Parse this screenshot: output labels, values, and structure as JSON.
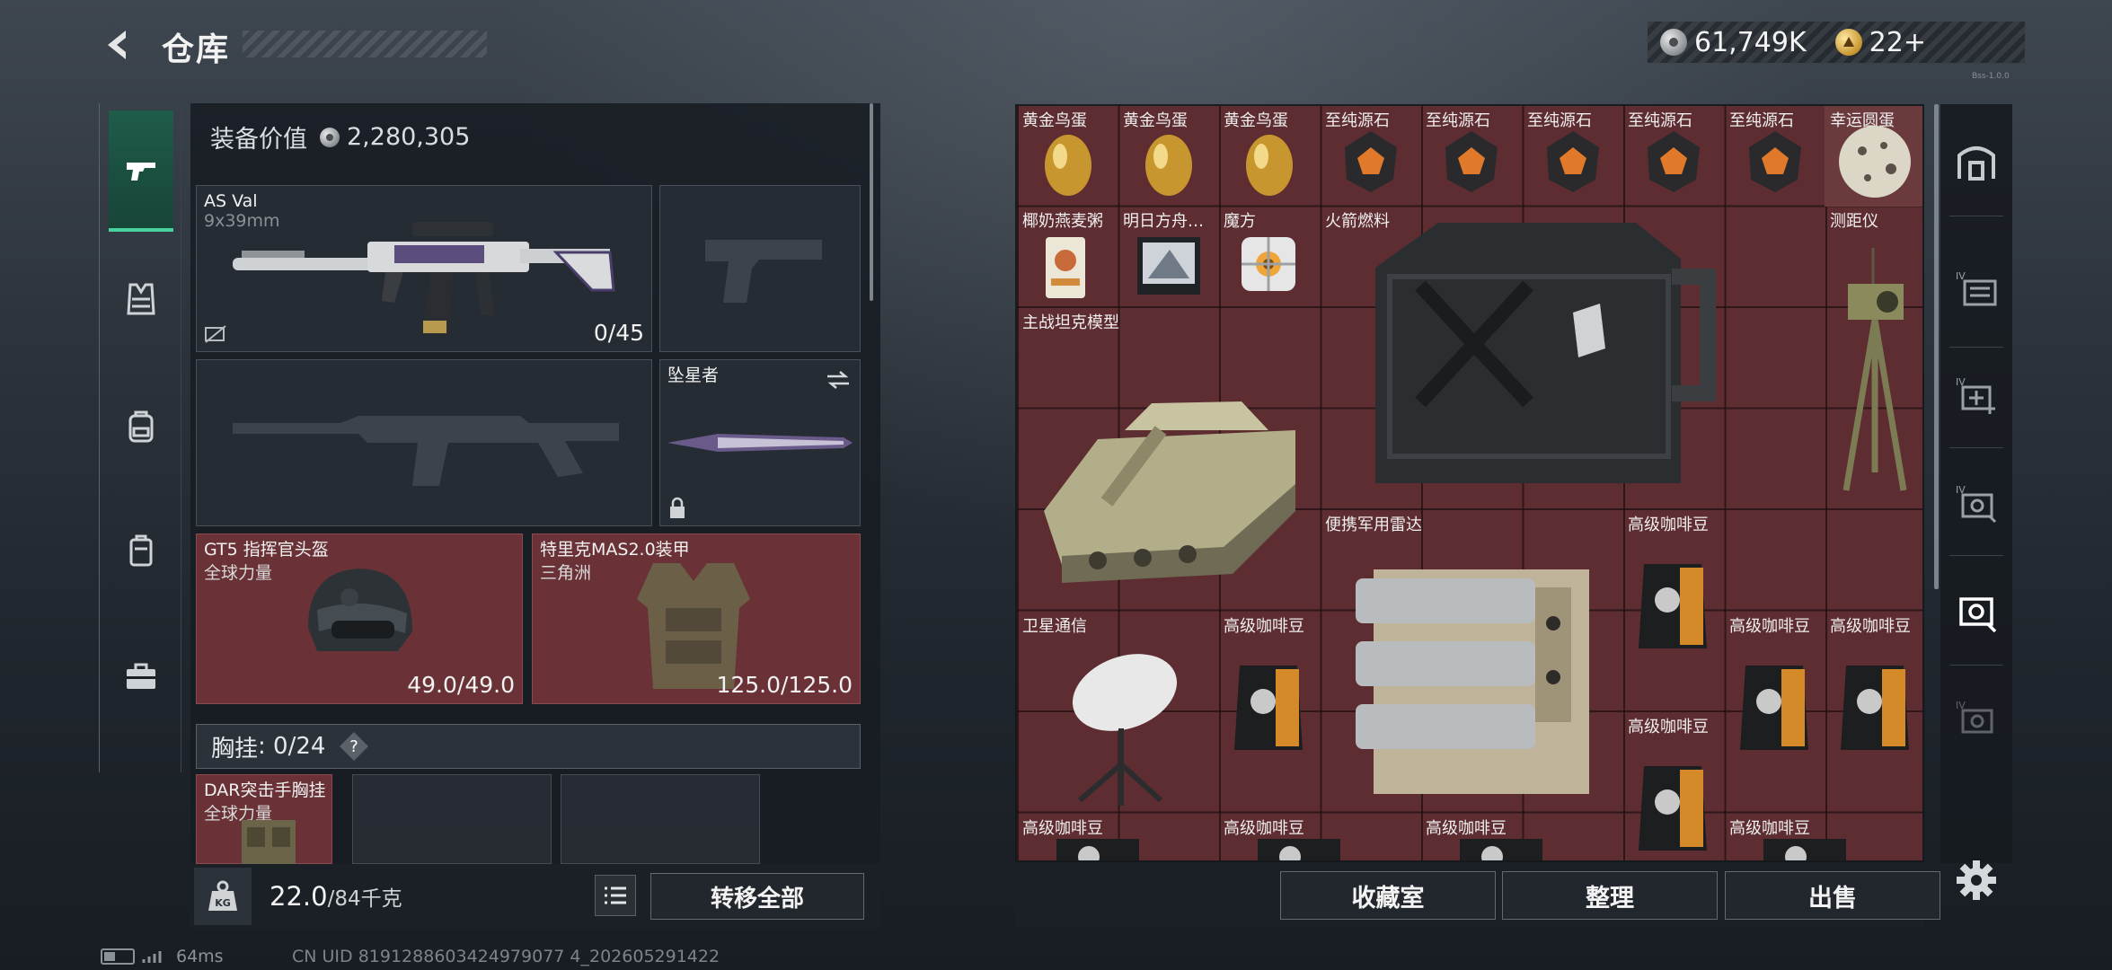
{
  "header": {
    "title": "仓库",
    "currency_silver": "61,749K",
    "currency_gold": "22+",
    "version_tag": "Bss-1.0.0"
  },
  "equipment": {
    "value_label": "装备价值",
    "value": "2,280,305",
    "primary": {
      "name": "AS Val",
      "caliber": "9x39mm",
      "ammo": "0/45"
    },
    "melee": {
      "name": "坠星者"
    },
    "helmet": {
      "name": "GT5 指挥官头盔",
      "sub": "全球力量",
      "durability": "49.0/49.0"
    },
    "armor": {
      "name": "特里克MAS2.0装甲",
      "sub": "三角洲",
      "durability": "125.0/125.0"
    },
    "chest_rig": {
      "label": "胸挂",
      "count": "0/24",
      "help": "?",
      "name": "DAR突击手胸挂",
      "sub": "全球力量"
    },
    "weight": {
      "current": "22.0",
      "max": "/84千克"
    },
    "transfer_all": "转移全部"
  },
  "storage": {
    "items": [
      {
        "name": "黄金鸟蛋",
        "icon": "golden-egg-icon"
      },
      {
        "name": "黄金鸟蛋",
        "icon": "golden-egg-icon"
      },
      {
        "name": "黄金鸟蛋",
        "icon": "golden-egg-icon"
      },
      {
        "name": "至纯源石",
        "icon": "source-stone-icon"
      },
      {
        "name": "至纯源石",
        "icon": "source-stone-icon"
      },
      {
        "name": "至纯源石",
        "icon": "source-stone-icon"
      },
      {
        "name": "至纯源石",
        "icon": "source-stone-icon"
      },
      {
        "name": "至纯源石",
        "icon": "source-stone-icon"
      },
      {
        "name": "幸运圆蛋",
        "icon": "lucky-egg-icon"
      },
      {
        "name": "椰奶燕麦粥",
        "icon": "oat-porridge-icon"
      },
      {
        "name": "明日方舟…",
        "icon": "arknights-ost-icon"
      },
      {
        "name": "魔方",
        "icon": "cube-icon"
      },
      {
        "name": "火箭燃料",
        "icon": "fuel-can-icon"
      },
      {
        "name": "测距仪",
        "icon": "rangefinder-icon"
      },
      {
        "name": "主战坦克模型",
        "icon": "tank-model-icon"
      },
      {
        "name": "便携军用雷达",
        "icon": "radar-icon"
      },
      {
        "name": "高级咖啡豆",
        "icon": "coffee-bag-icon"
      },
      {
        "name": "卫星通信",
        "icon": "satellite-dish-icon"
      },
      {
        "name": "高级咖啡豆",
        "icon": "coffee-bag-icon"
      },
      {
        "name": "高级咖啡豆",
        "icon": "coffee-bag-icon"
      },
      {
        "name": "高级咖啡豆",
        "icon": "coffee-bag-icon"
      },
      {
        "name": "高级咖啡豆",
        "icon": "coffee-bag-icon"
      },
      {
        "name": "高级咖啡豆",
        "icon": "coffee-bag-icon"
      },
      {
        "name": "高级咖啡豆",
        "icon": "coffee-bag-icon"
      },
      {
        "name": "高级咖啡豆",
        "icon": "coffee-bag-icon"
      },
      {
        "name": "高级咖啡豆",
        "icon": "coffee-bag-icon"
      }
    ],
    "buttons": {
      "collection": "收藏室",
      "sort": "整理",
      "sell": "出售"
    }
  },
  "status_bar": {
    "ping": "64ms",
    "uid": "CN UID 8191288603424979077 4_202605291422"
  },
  "colors": {
    "accent": "#49d2a0",
    "item_bg": "#5d2d31",
    "gold": "#c8962e"
  }
}
